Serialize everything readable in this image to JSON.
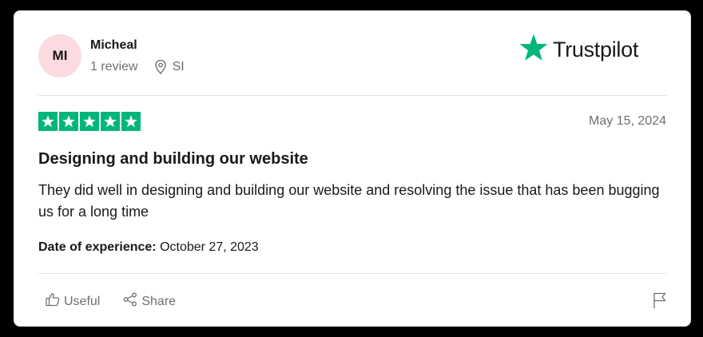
{
  "reviewer": {
    "initials": "MI",
    "name": "Micheal",
    "review_count": "1 review",
    "country": "SI"
  },
  "brand": {
    "name": "Trustpilot",
    "color": "#00b67a"
  },
  "review": {
    "rating": 5,
    "max_rating": 5,
    "date": "May 15, 2024",
    "title": "Designing and building our website",
    "body": "They did well in designing and building our website and resolving the issue that has been bugging us for a long time",
    "experience_label": "Date of experience:",
    "experience_date": "October 27, 2023"
  },
  "actions": {
    "useful_label": "Useful",
    "share_label": "Share"
  },
  "icons": {
    "location": "map-pin-icon",
    "useful": "thumbs-up-icon",
    "share": "share-icon",
    "report": "flag-icon",
    "star": "star-icon"
  },
  "colors": {
    "avatar_bg": "#fbdbe0",
    "star_green": "#00b67a",
    "muted_text": "#6f6f6f"
  }
}
